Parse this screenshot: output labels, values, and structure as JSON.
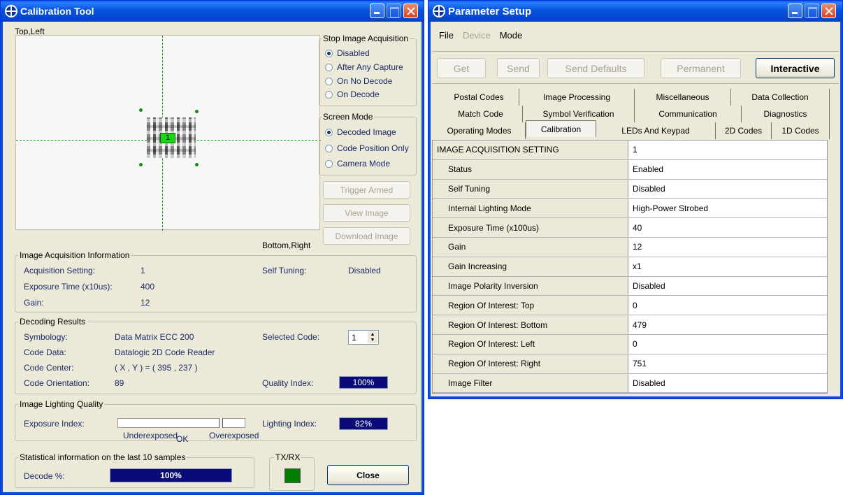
{
  "calib": {
    "title": "Calibration Tool",
    "top_left": "Top,Left",
    "bottom_right": "Bottom,Right",
    "code_label": "1",
    "stop": {
      "legend": "Stop Image Acquisition",
      "options": [
        "Disabled",
        "After Any Capture",
        "On No Decode",
        "On Decode"
      ],
      "selected": "Disabled"
    },
    "screen": {
      "legend": "Screen Mode",
      "options": [
        "Decoded Image",
        "Code Position Only",
        "Camera Mode"
      ],
      "selected": "Decoded Image"
    },
    "buttons": {
      "trigger": "Trigger Armed",
      "view": "View Image",
      "download": "Download Image",
      "close": "Close"
    },
    "acq": {
      "legend": "Image Acquisition Information",
      "setting_label": "Acquisition Setting:",
      "setting": "1",
      "exposure_label": "Exposure Time (x10us):",
      "exposure": "400",
      "gain_label": "Gain:",
      "gain": "12",
      "tuning_label": "Self Tuning:",
      "tuning": "Disabled"
    },
    "dec": {
      "legend": "Decoding Results",
      "symbology_label": "Symbology:",
      "symbology": "Data Matrix ECC 200",
      "data_label": "Code Data:",
      "data": "Datalogic 2D Code Reader",
      "center_label": "Code Center:",
      "center": "( X , Y ) = ( 395 , 237 )",
      "orient_label": "Code Orientation:",
      "orient": "89",
      "selected_label": "Selected Code:",
      "selected": "1",
      "quality_label": "Quality Index:",
      "quality": "100%"
    },
    "light": {
      "legend": "Image Lighting Quality",
      "exposure_label": "Exposure Index:",
      "under": "Underexposed",
      "ok": "OK",
      "over": "Overexposed",
      "index_label": "Lighting Index:",
      "index": "82%"
    },
    "stats": {
      "legend": "Statistical information on the last 10 samples",
      "decode_label": "Decode %:",
      "decode": "100%"
    },
    "txrx": "TX/RX",
    "status_color": "#008000"
  },
  "param": {
    "title": "Parameter Setup",
    "menu": [
      "File",
      "Device",
      "Mode"
    ],
    "toolbar": {
      "get": "Get",
      "send": "Send",
      "defaults": "Send Defaults",
      "permanent": "Permanent",
      "interactive": "Interactive"
    },
    "tabs_row1": [
      "Postal Codes",
      "Image Processing",
      "Miscellaneous",
      "Data Collection"
    ],
    "tabs_row2": [
      "Match Code",
      "Symbol Verification",
      "Communication",
      "Diagnostics"
    ],
    "tabs_row3": [
      "Operating Modes",
      "Calibration",
      "LEDs And Keypad",
      "2D Codes",
      "1D Codes"
    ],
    "active_tab": "Calibration",
    "rows": [
      {
        "k": "IMAGE ACQUISITION SETTING",
        "v": "1"
      },
      {
        "k": "Status",
        "v": "Enabled"
      },
      {
        "k": "Self Tuning",
        "v": "Disabled"
      },
      {
        "k": "Internal Lighting Mode",
        "v": "High-Power Strobed"
      },
      {
        "k": "Exposure Time (x100us)",
        "v": "40"
      },
      {
        "k": "Gain",
        "v": "12"
      },
      {
        "k": "Gain Increasing",
        "v": "x1"
      },
      {
        "k": "Image Polarity Inversion",
        "v": "Disabled"
      },
      {
        "k": "Region Of Interest: Top",
        "v": "0"
      },
      {
        "k": "Region Of Interest: Bottom",
        "v": "479"
      },
      {
        "k": "Region Of Interest: Left",
        "v": "0"
      },
      {
        "k": "Region Of Interest: Right",
        "v": "751"
      },
      {
        "k": "Image Filter",
        "v": "Disabled"
      }
    ]
  },
  "icons": [
    "app-icon",
    "minimize-icon",
    "maximize-icon",
    "close-icon",
    "spin-up-icon",
    "spin-down-icon"
  ]
}
